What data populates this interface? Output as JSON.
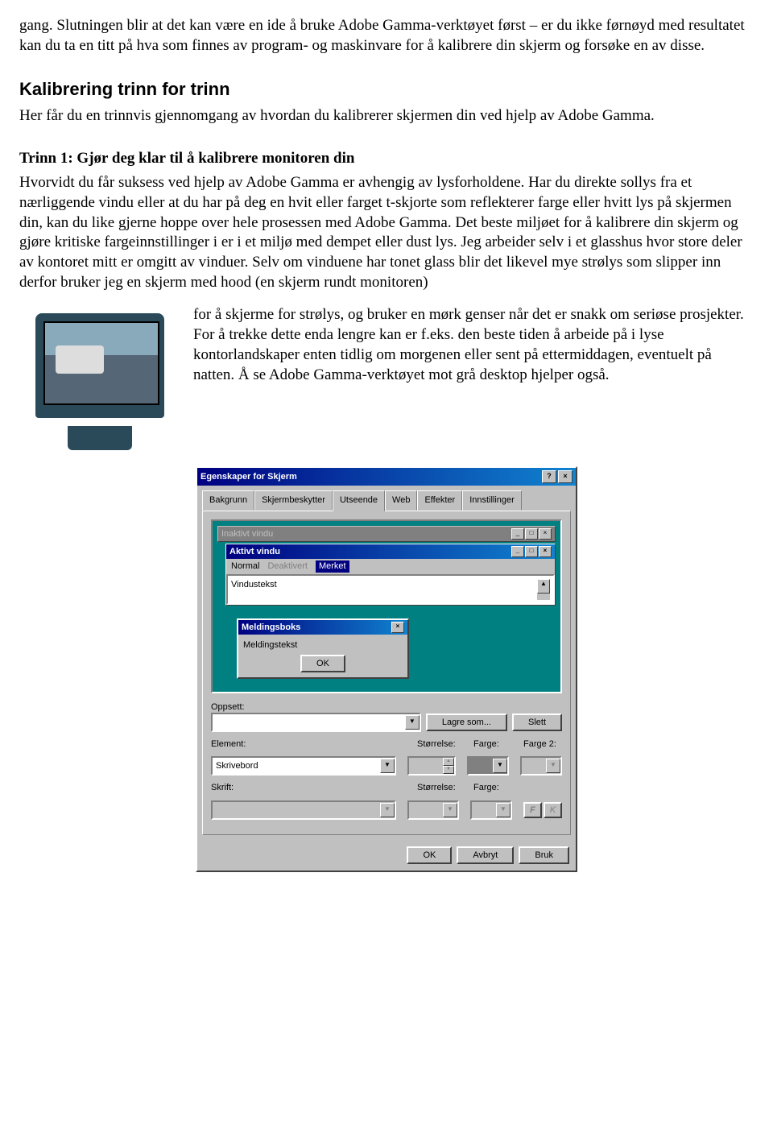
{
  "intro_para": "gang. Slutningen blir at det kan være en ide å bruke Adobe Gamma-verktøyet først – er du ikke førnøyd med resultatet kan du ta en titt på hva som finnes av program- og maskinvare for å kalibrere din skjerm og forsøke en av disse.",
  "h2": "Kalibrering trinn for trinn",
  "h2_sub": "Her får du en trinnvis gjennomgang av hvordan du kalibrerer skjermen din ved hjelp av Adobe Gamma.",
  "h3": "Trinn 1: Gjør deg klar til å kalibrere monitoren din",
  "trinn1_para": "Hvorvidt du får suksess ved hjelp av Adobe Gamma er avhengig av lysforholdene. Har du direkte sollys fra et nærliggende vindu eller at du har på deg en hvit eller farget t-skjorte som reflekterer farge eller hvitt lys på skjermen din, kan du like gjerne hoppe over hele prosessen med Adobe Gamma. Det beste miljøet for å kalibrere din skjerm og gjøre kritiske fargeinnstillinger i er i et miljø med dempet eller dust lys. Jeg arbeider selv i et glasshus hvor store deler av kontoret mitt er omgitt av vinduer. Selv om vinduene har tonet glass blir det likevel mye strølys som slipper inn derfor bruker jeg en skjerm med hood (en skjerm rundt monitoren)",
  "monitor_para": "for å skjerme for strølys, og bruker en mørk genser når det er snakk om seriøse prosjekter. For å trekke dette enda lengre kan er f.eks. den beste tiden å arbeide på i lyse kontorlandskaper enten tidlig om morgenen eller sent på ettermiddagen, eventuelt på natten. Å se Adobe Gamma-verktøyet mot grå desktop hjelper også.",
  "dialog": {
    "title": "Egenskaper for Skjerm",
    "tabs": [
      "Bakgrunn",
      "Skjermbeskytter",
      "Utseende",
      "Web",
      "Effekter",
      "Innstillinger"
    ],
    "inactive_title": "Inaktivt vindu",
    "active_title": "Aktivt vindu",
    "menu_normal": "Normal",
    "menu_disabled": "Deaktivert",
    "menu_selected": "Merket",
    "textarea": "Vindustekst",
    "msgbox_title": "Meldingsboks",
    "msgbox_text": "Meldingstekst",
    "ok": "OK",
    "oppsett_label": "Oppsett:",
    "lagre_som": "Lagre som...",
    "slett": "Slett",
    "element_label": "Element:",
    "storrelse_label": "Størrelse:",
    "farge_label": "Farge:",
    "farge2_label": "Farge 2:",
    "element_value": "Skrivebord",
    "skrift_label": "Skrift:",
    "f_btn": "F",
    "k_btn": "K",
    "btn_ok": "OK",
    "btn_avbryt": "Avbryt",
    "btn_bruk": "Bruk"
  }
}
